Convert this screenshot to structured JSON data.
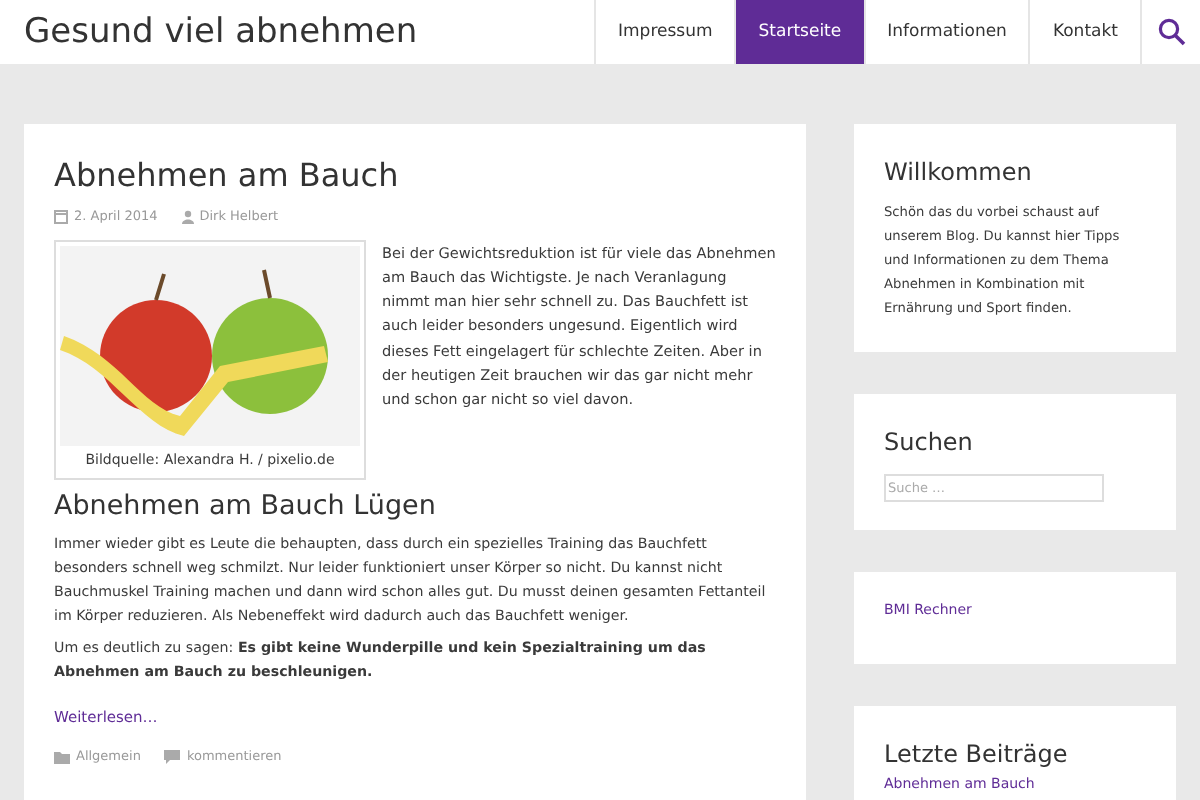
{
  "site_title": "Gesund viel abnehmen",
  "nav": [
    {
      "label": "Impressum",
      "selected": false
    },
    {
      "label": "Startseite",
      "selected": true
    },
    {
      "label": "Informationen",
      "selected": false
    },
    {
      "label": "Kontakt",
      "selected": false
    }
  ],
  "post": {
    "title": "Abnehmen am Bauch",
    "date": "2. April 2014",
    "author": "Dirk Helbert",
    "image_caption": "Bildquelle: Alexandra H. / pixelio.de",
    "intro": "Bei der Gewichtsreduktion ist für viele das Abnehmen am Bauch das Wichtigste. Je nach Veranlagung nimmt man hier sehr schnell zu. Das Bauchfett ist auch leider besonders ungesund. Eigentlich wird dieses Fett eingelagert für schlechte Zeiten. Aber in der heutigen Zeit brauchen wir das gar nicht mehr und schon gar nicht so viel davon.",
    "subheading": "Abnehmen am Bauch Lügen",
    "paragraphs": [
      "Immer wieder gibt es Leute die behaupten, dass durch ein spezielles Training das Bauchfett besonders schnell weg schmilzt. Nur leider funktioniert unser Körper so nicht. Du kannst nicht Bauchmuskel Training machen und dann wird schon alles gut. Du musst deinen gesamten Fettanteil im Körper reduzieren. Als Nebeneffekt wird dadurch auch das Bauchfett weniger.",
      "Um es deutlich zu sagen: **Es gibt keine Wunderpille und kein Spezialtraining um das Abnehmen am Bauch zu beschleunigen.**"
    ],
    "read_more": "Weiterlesen…",
    "category": "Allgemein",
    "comments": "kommentieren"
  },
  "sidebar": {
    "welcome": {
      "title": "Willkommen",
      "text": "Schön das du vorbei schaust auf unserem Blog. Du kannst hier Tipps und Informationen zu dem Thema Abnehmen in Kombination mit Ernährung und Sport finden."
    },
    "search": {
      "title": "Suchen",
      "placeholder": "Suche …"
    },
    "links": [
      "BMI Rechner"
    ],
    "recent": {
      "title": "Letzte Beiträge",
      "items": [
        "Abnehmen am Bauch"
      ]
    }
  }
}
